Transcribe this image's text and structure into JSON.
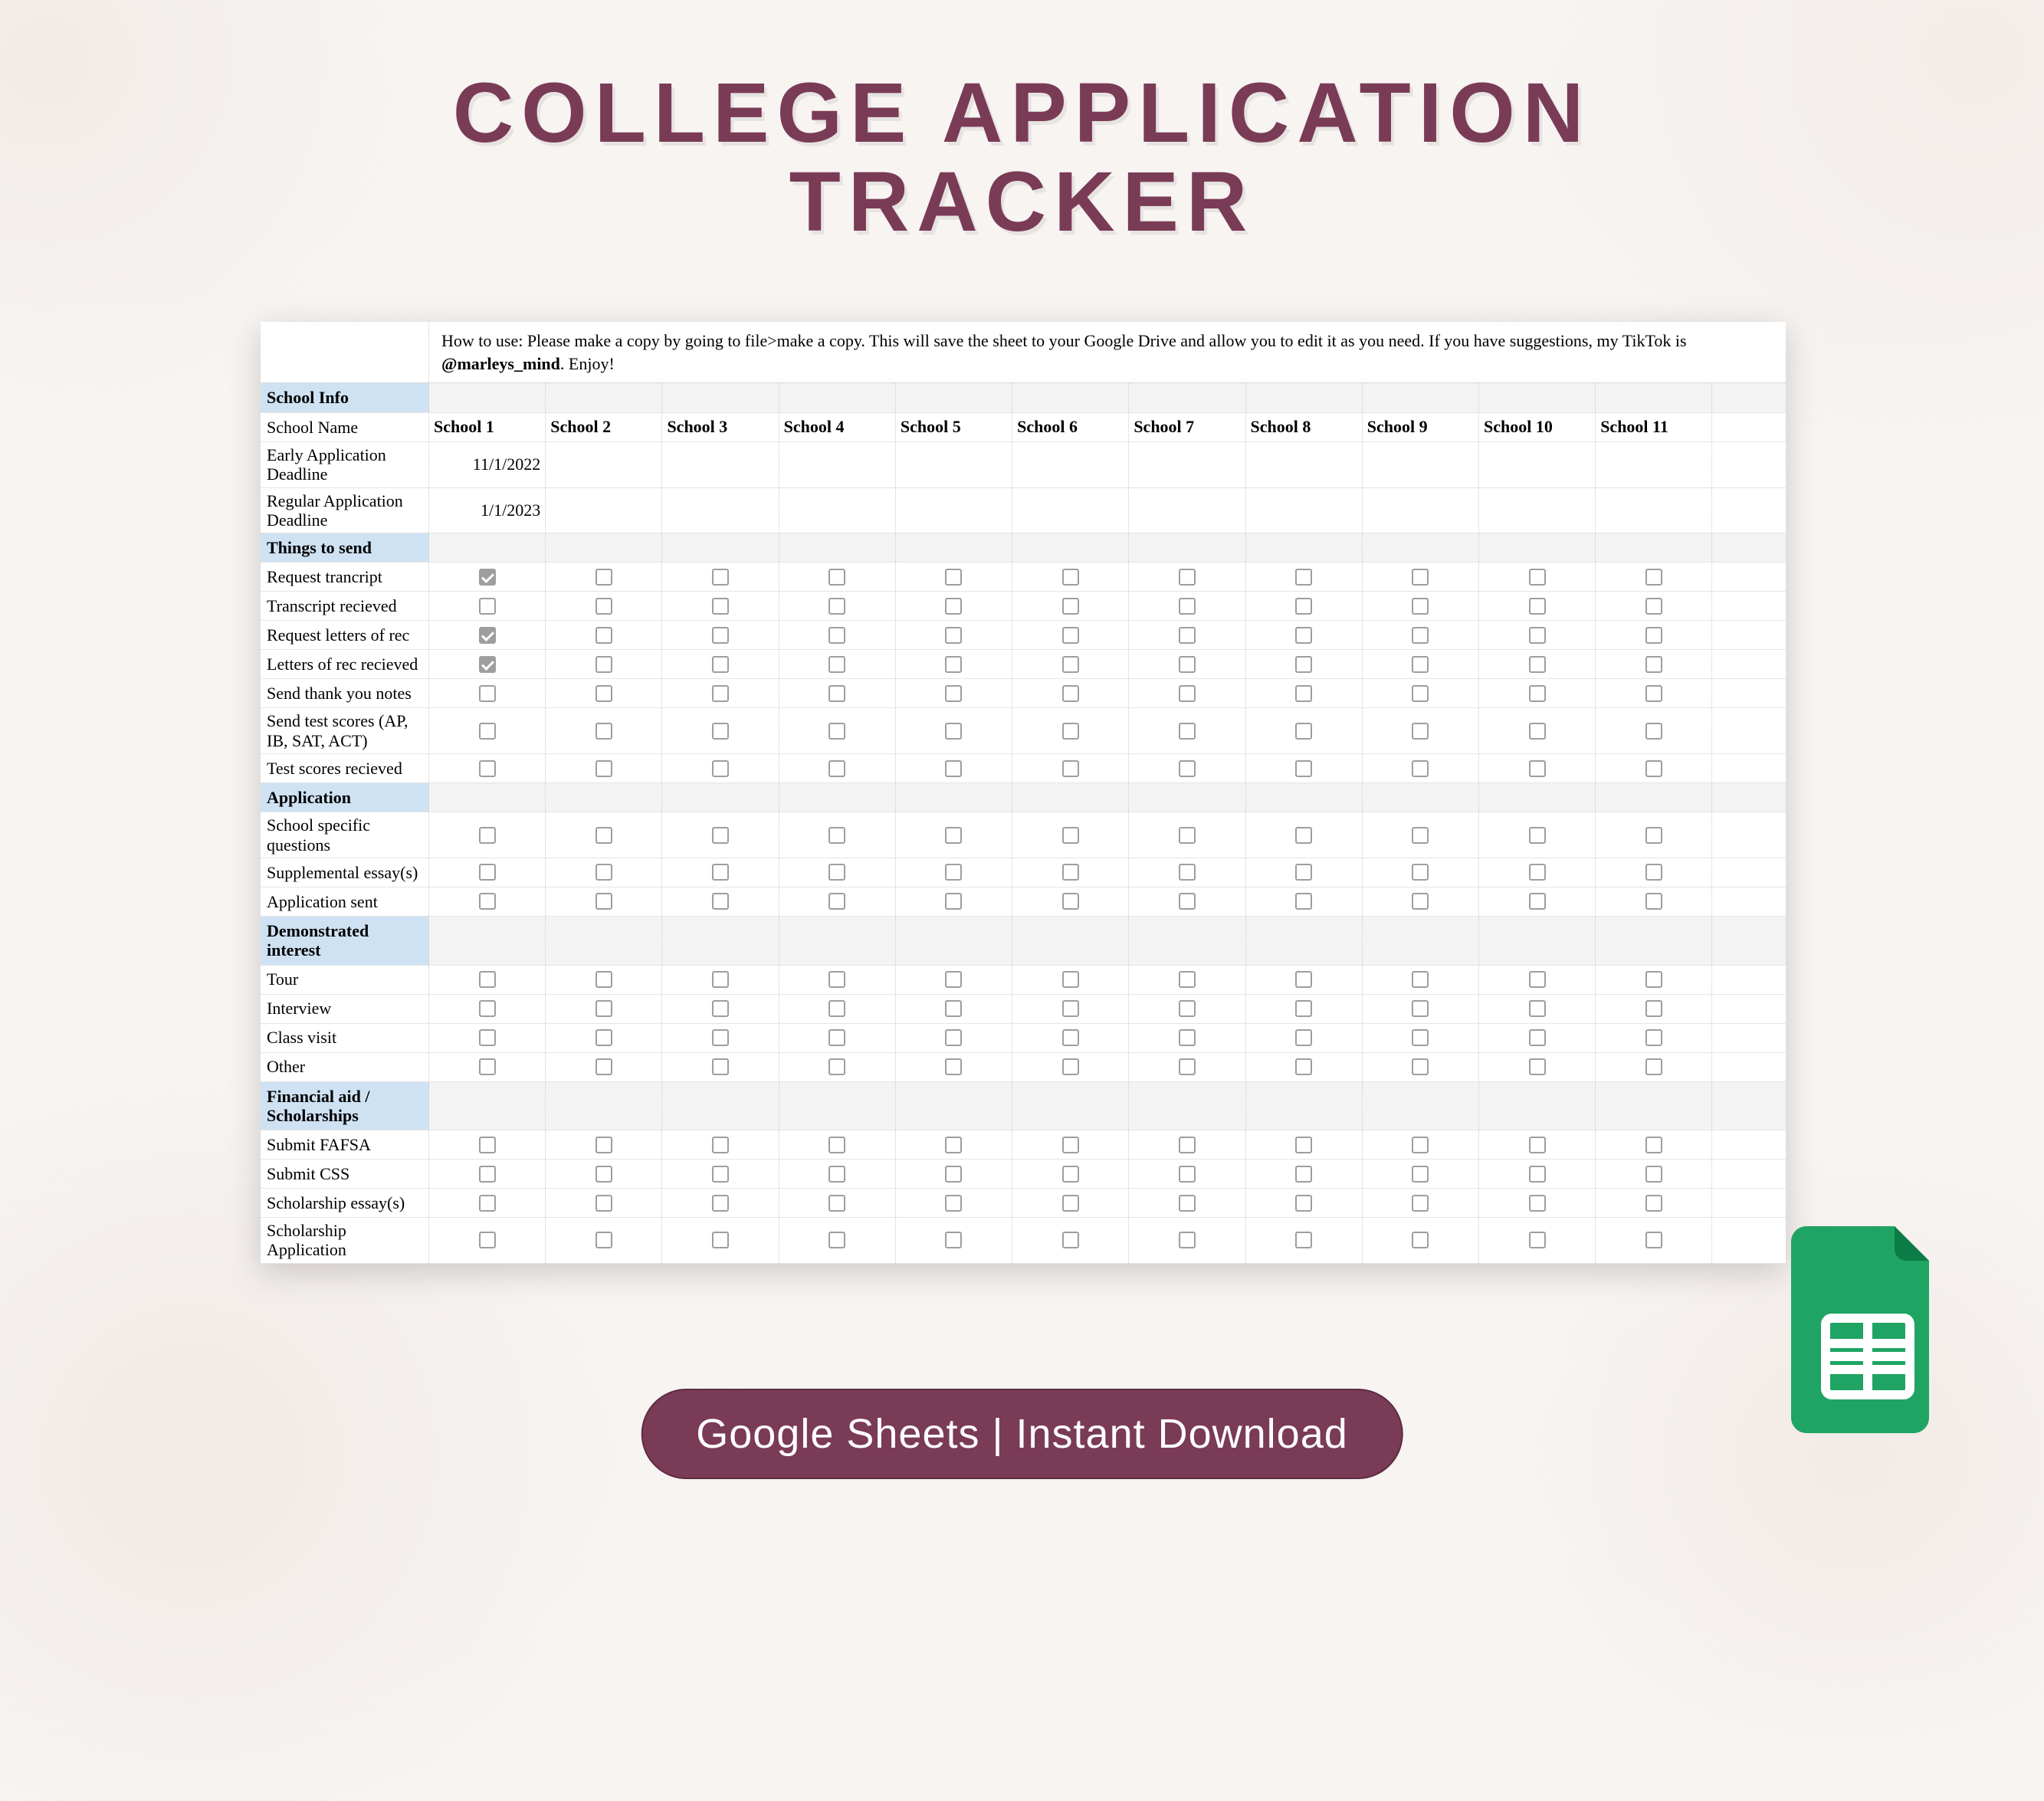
{
  "title_line1": "COLLEGE APPLICATION",
  "title_line2": "TRACKER",
  "howto_prefix": "How to use: Please make a copy by going to file>make a copy. This will save the sheet to your Google Drive and allow you to edit it as you need. If you have suggestions, my TikTok is ",
  "howto_handle": "@marleys_mind",
  "howto_suffix": ". Enjoy!",
  "schools": [
    "School 1",
    "School 2",
    "School 3",
    "School 4",
    "School 5",
    "School 6",
    "School 7",
    "School 8",
    "School 9",
    "School 10",
    "School 11"
  ],
  "sections": [
    {
      "title": "School Info",
      "rows": [
        {
          "label": "School Name",
          "type": "header",
          "values": "schools"
        },
        {
          "label": "Early Application Deadline",
          "type": "text",
          "values": [
            "11/1/2022",
            "",
            "",
            "",
            "",
            "",
            "",
            "",
            "",
            "",
            ""
          ],
          "align": "right"
        },
        {
          "label": "Regular Application Deadline",
          "type": "text",
          "values": [
            "1/1/2023",
            "",
            "",
            "",
            "",
            "",
            "",
            "",
            "",
            "",
            ""
          ],
          "align": "right"
        }
      ]
    },
    {
      "title": "Things to send",
      "rows": [
        {
          "label": "Request trancript",
          "type": "check",
          "checked": [
            true,
            false,
            false,
            false,
            false,
            false,
            false,
            false,
            false,
            false,
            false
          ]
        },
        {
          "label": "Transcript recieved",
          "type": "check",
          "checked": [
            false,
            false,
            false,
            false,
            false,
            false,
            false,
            false,
            false,
            false,
            false
          ]
        },
        {
          "label": "Request letters of rec",
          "type": "check",
          "checked": [
            true,
            false,
            false,
            false,
            false,
            false,
            false,
            false,
            false,
            false,
            false
          ]
        },
        {
          "label": "Letters of rec recieved",
          "type": "check",
          "checked": [
            true,
            false,
            false,
            false,
            false,
            false,
            false,
            false,
            false,
            false,
            false
          ]
        },
        {
          "label": "Send thank you notes",
          "type": "check",
          "checked": [
            false,
            false,
            false,
            false,
            false,
            false,
            false,
            false,
            false,
            false,
            false
          ]
        },
        {
          "label": "Send test scores (AP, IB, SAT, ACT)",
          "type": "check",
          "checked": [
            false,
            false,
            false,
            false,
            false,
            false,
            false,
            false,
            false,
            false,
            false
          ]
        },
        {
          "label": "Test scores recieved",
          "type": "check",
          "checked": [
            false,
            false,
            false,
            false,
            false,
            false,
            false,
            false,
            false,
            false,
            false
          ]
        }
      ]
    },
    {
      "title": "Application",
      "rows": [
        {
          "label": "School specific questions",
          "type": "check",
          "checked": [
            false,
            false,
            false,
            false,
            false,
            false,
            false,
            false,
            false,
            false,
            false
          ]
        },
        {
          "label": "Supplemental essay(s)",
          "type": "check",
          "checked": [
            false,
            false,
            false,
            false,
            false,
            false,
            false,
            false,
            false,
            false,
            false
          ]
        },
        {
          "label": "Application sent",
          "type": "check",
          "checked": [
            false,
            false,
            false,
            false,
            false,
            false,
            false,
            false,
            false,
            false,
            false
          ]
        }
      ]
    },
    {
      "title": "Demonstrated interest",
      "rows": [
        {
          "label": "Tour",
          "type": "check",
          "checked": [
            false,
            false,
            false,
            false,
            false,
            false,
            false,
            false,
            false,
            false,
            false
          ]
        },
        {
          "label": "Interview",
          "type": "check",
          "checked": [
            false,
            false,
            false,
            false,
            false,
            false,
            false,
            false,
            false,
            false,
            false
          ]
        },
        {
          "label": "Class visit",
          "type": "check",
          "checked": [
            false,
            false,
            false,
            false,
            false,
            false,
            false,
            false,
            false,
            false,
            false
          ]
        },
        {
          "label": "Other",
          "type": "check",
          "checked": [
            false,
            false,
            false,
            false,
            false,
            false,
            false,
            false,
            false,
            false,
            false
          ]
        }
      ]
    },
    {
      "title": "Financial aid / Scholarships",
      "rows": [
        {
          "label": "Submit FAFSA",
          "type": "check",
          "checked": [
            false,
            false,
            false,
            false,
            false,
            false,
            false,
            false,
            false,
            false,
            false
          ]
        },
        {
          "label": "Submit CSS",
          "type": "check",
          "checked": [
            false,
            false,
            false,
            false,
            false,
            false,
            false,
            false,
            false,
            false,
            false
          ]
        },
        {
          "label": "Scholarship essay(s)",
          "type": "check",
          "checked": [
            false,
            false,
            false,
            false,
            false,
            false,
            false,
            false,
            false,
            false,
            false
          ]
        },
        {
          "label": "Scholarship Application",
          "type": "check",
          "checked": [
            false,
            false,
            false,
            false,
            false,
            false,
            false,
            false,
            false,
            false,
            false
          ]
        }
      ]
    }
  ],
  "pill_text": "Google Sheets | Instant Download"
}
